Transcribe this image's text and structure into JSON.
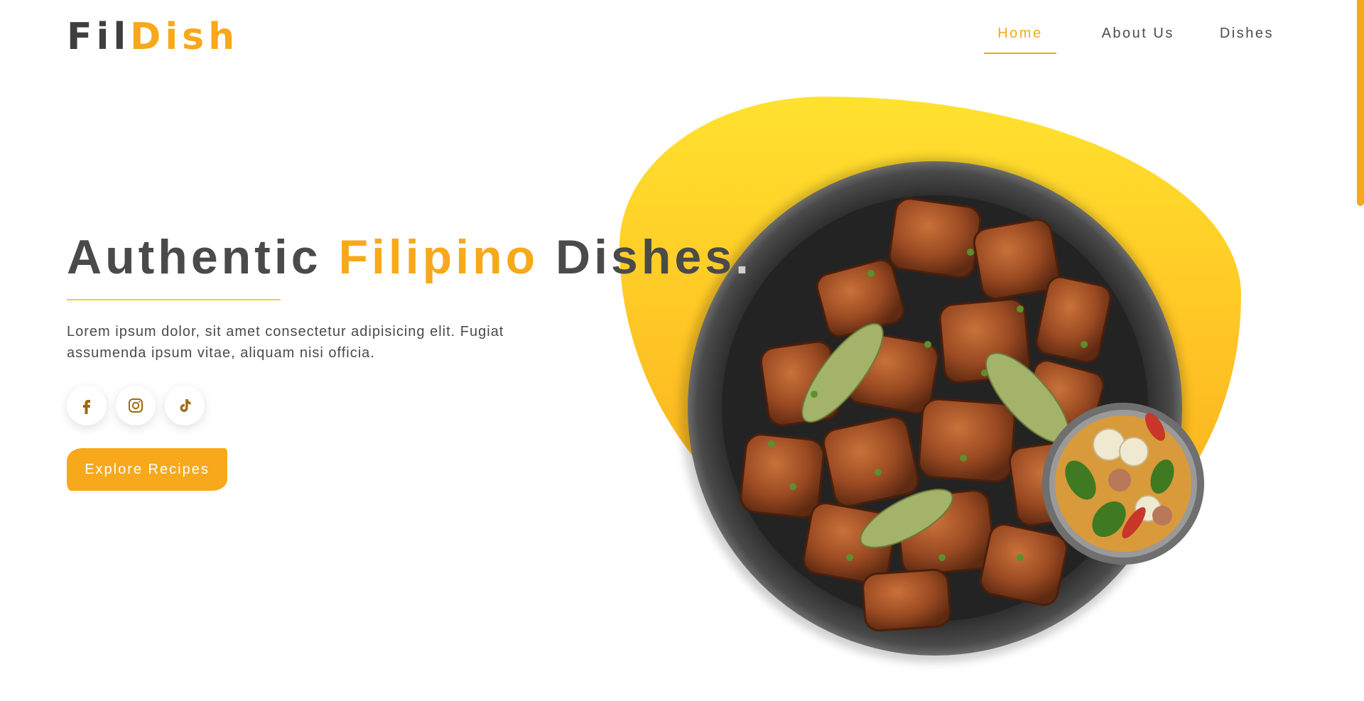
{
  "brand": {
    "part1": "Fil",
    "part2": "Dish"
  },
  "nav": {
    "items": [
      "Home",
      "About Us",
      "Dishes"
    ],
    "active": "Home"
  },
  "hero": {
    "title_part1": "Authentic ",
    "title_accent": "Filipino",
    "title_part2": " Dishes",
    "title_end": ".",
    "description": "Lorem ipsum dolor, sit amet consectetur adipisicing elit. Fugiat assumenda ipsum vitae, aliquam nisi officia.",
    "cta_label": "Explore Recipes"
  },
  "socials": [
    {
      "name": "facebook",
      "icon": "facebook-icon"
    },
    {
      "name": "instagram",
      "icon": "instagram-icon"
    },
    {
      "name": "tiktok",
      "icon": "tiktok-icon"
    }
  ],
  "images": {
    "main_dish": "bowl of adobo pork with bay leaves and thyme",
    "side_dish": "small bowl of sinigang soup with chili and vegetables"
  },
  "colors": {
    "accent": "#f7a81b",
    "text": "#4a4a4a",
    "blob_top": "#ffe22f",
    "blob_bottom": "#f7a81b"
  }
}
